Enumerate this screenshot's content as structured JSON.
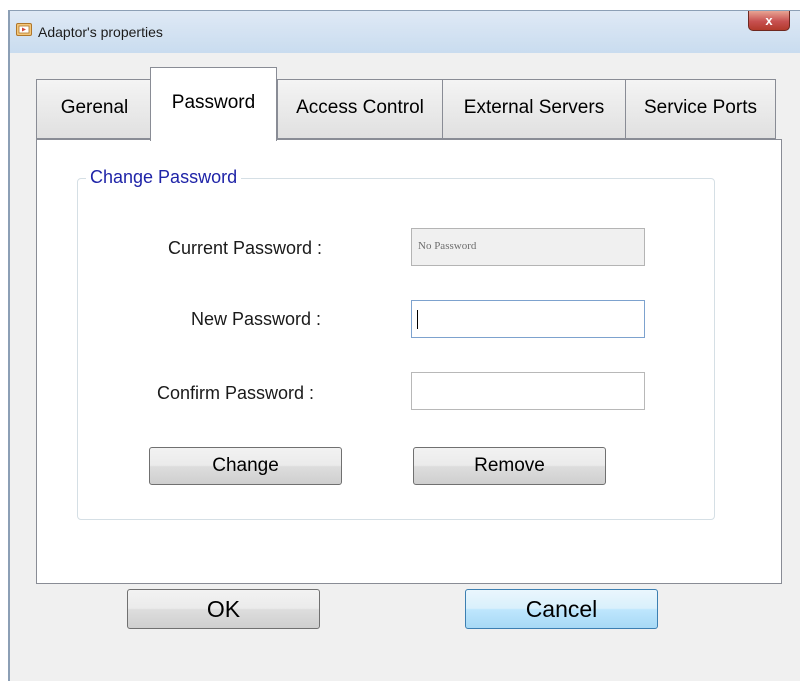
{
  "window": {
    "title": "Adaptor's properties",
    "close_label": "x"
  },
  "tabs": [
    {
      "label": "Gerenal",
      "active": false
    },
    {
      "label": "Password",
      "active": true
    },
    {
      "label": "Access Control",
      "active": false
    },
    {
      "label": "External Servers",
      "active": false
    },
    {
      "label": "Service Ports",
      "active": false
    }
  ],
  "change_password": {
    "legend": "Change Password",
    "current_password": {
      "label": "Current Password :",
      "value": "No Password",
      "enabled": false
    },
    "new_password": {
      "label": "New Password :",
      "value": "",
      "focused": true
    },
    "confirm_password": {
      "label": "Confirm Password :",
      "value": ""
    },
    "change_button": "Change",
    "remove_button": "Remove"
  },
  "footer": {
    "ok_button": "OK",
    "cancel_button": "Cancel"
  },
  "icons": {
    "title_icon": "app-window-icon",
    "close_icon": "close-icon"
  },
  "colors": {
    "legend_text": "#1f24a8",
    "close_button": "#c75050",
    "default_button": "#bee6fd"
  }
}
